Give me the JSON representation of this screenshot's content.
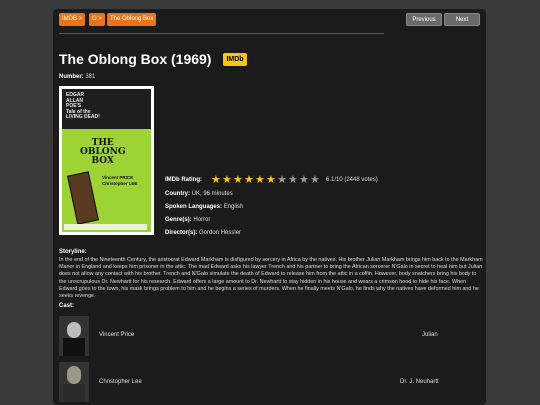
{
  "breadcrumbs": [
    "IMDB >",
    "O >",
    "The Oblong Box"
  ],
  "nav": {
    "previous": "Previous",
    "next": "Next"
  },
  "movie": {
    "title": "The Oblong Box (1969)",
    "imdb_badge": "IMDb",
    "number_label": "Number:",
    "number": "381",
    "rating_label": "IMDb Rating:",
    "rating_stars": 6.1,
    "rating_max": 10,
    "rating_text": "6.1/10 (2448 votes)",
    "country_label": "Country:",
    "country": "UK, 96 minutes",
    "languages_label": "Spoken Languages:",
    "languages": "English",
    "genres_label": "Genre(s):",
    "genres": "Horror",
    "directors_label": "Director(s):",
    "directors": "Gordon Hessler",
    "storyline_label": "Storyline:",
    "storyline": "In the end of the Nineteenth Century, the aristocrat Edward Markham is disfigured by sorcery in Africa by the natives. His brother Julian Markham brings him back to the Markham Manor in England and keeps him prisoner in the attic. The mad Edward asks his lawyer Trench and his partner to bring the African sorcerer N'Galo in secret to heal him but Julian does not allow any contact with his brother. Trench and N'Galo simulate the death of Edward to release him from the attic in a coffin. However, body snatchers bring his body to the unscrupulous Dr. Newhartt for his research. Edward offers a large amount to Dr. Newhartt to stay hidden in his house and wears a crimson hood to hide his face. When Edward goes to the town, his mask brings problem to him and he begins a series of murders. When he finally meets N'Galo, he finds why the natives have deformed him and he seeks revenge.",
    "cast_label": "Cast:",
    "cast": [
      {
        "actor": "Vincent Price",
        "role": "Julian"
      },
      {
        "actor": "Christopher Lee",
        "role": "Dr. J. Neuhartt"
      }
    ]
  },
  "poster": {
    "top_text": [
      "EDGAR",
      "ALLAN",
      "POE'S",
      "Tale of the",
      "LIVING DEAD!"
    ],
    "title_lines": [
      "THE",
      "OBLONG",
      "BOX"
    ],
    "stars_text": [
      "Vincent PRICE",
      "Christopher LEE"
    ],
    "colors": {
      "bg": "#9ed336",
      "ink": "#111111"
    }
  },
  "colors": {
    "accent": "#e8751a",
    "star_on": "#f5c518",
    "star_off": "#999999"
  }
}
